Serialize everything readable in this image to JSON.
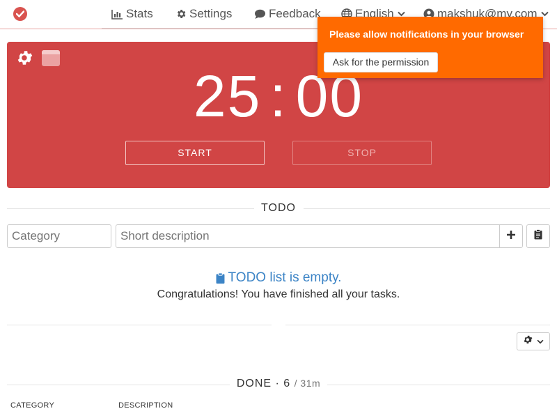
{
  "navbar": {
    "brand_icon": "check-circle-icon",
    "items": [
      {
        "label": "Stats",
        "icon": "bar-chart-icon"
      },
      {
        "label": "Settings",
        "icon": "gear-icon"
      },
      {
        "label": "Feedback",
        "icon": "comment-icon"
      },
      {
        "label": "English",
        "icon": "globe-icon"
      },
      {
        "label": "makshuk@my.com",
        "icon": "user-circle-icon"
      }
    ]
  },
  "notification": {
    "message": "Please allow notifications in your browser",
    "button_label": "Ask for the permission",
    "color": "#ff6a00"
  },
  "timer": {
    "minutes": "25",
    "separator": ":",
    "seconds": "00",
    "start_label": "START",
    "stop_label": "STOP",
    "panel_color": "#d14545"
  },
  "todo": {
    "title": "TODO",
    "category_placeholder": "Category",
    "description_placeholder": "Short description",
    "empty_title": "TODO list is empty.",
    "empty_subtitle": "Congratulations! You have finished all your tasks."
  },
  "done": {
    "title": "DONE",
    "dot": "·",
    "count": "6",
    "duration": "/ 31m",
    "columns": [
      "CATEGORY",
      "DESCRIPTION"
    ]
  }
}
